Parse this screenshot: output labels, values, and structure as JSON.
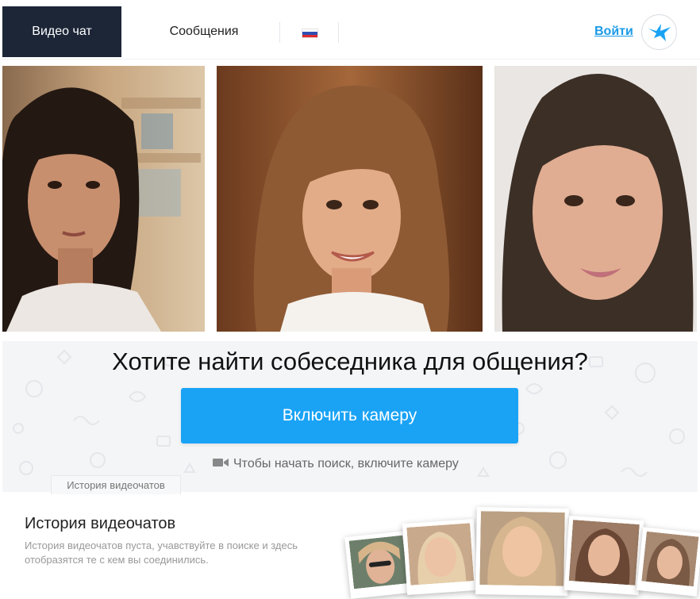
{
  "header": {
    "tab_video": "Видео чат",
    "tab_messages": "Сообщения",
    "login": "Войти",
    "language_flag": "russia-flag-icon",
    "logo_icon": "bird-logo-icon"
  },
  "cta": {
    "title": "Хотите найти собеседника для общения?",
    "button": "Включить камеру",
    "hint": "Чтобы начать поиск, включите камеру",
    "hint_icon": "video-camera-icon",
    "history_tab": "История видеочатов"
  },
  "history": {
    "title": "История видеочатов",
    "description": "История видеочатов пуста, учавствуйте в поиске и здесь отобразятся те с кем вы соединились."
  },
  "colors": {
    "active_tab": "#1c2637",
    "accent": "#1aa3f5",
    "link": "#1a9be6"
  }
}
